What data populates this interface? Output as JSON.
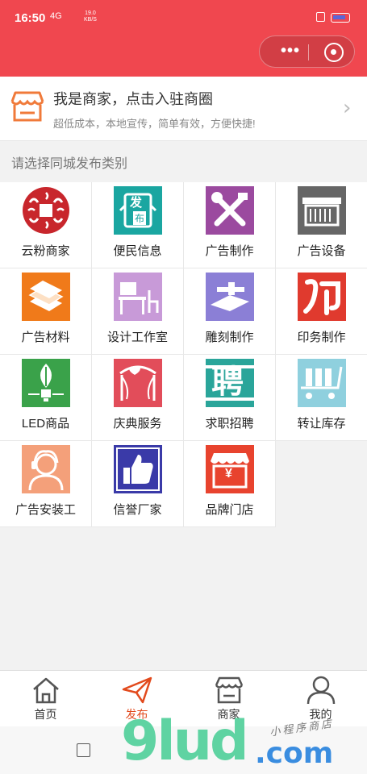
{
  "status_bar": {
    "time": "16:50",
    "signal": "4G",
    "net_speed_value": "19.0",
    "net_speed_unit": "KB/S"
  },
  "capsule": {
    "more_label": "•••"
  },
  "banner": {
    "title": "我是商家，点击入驻商圈",
    "subtitle": "超低成本，本地宣传，简单有效，方便快捷!",
    "accent_color": "#f07a3a"
  },
  "section_label": "请选择同城发布类别",
  "categories": [
    {
      "label": "云粉商家",
      "icon": "cloud-pattern-icon",
      "color": "#c8262c"
    },
    {
      "label": "便民信息",
      "icon": "announcement-icon",
      "color": "#1aa6a1",
      "icon_text_1": "发",
      "icon_text_2": "布"
    },
    {
      "label": "广告制作",
      "icon": "tools-icon",
      "color": "#9b4a9f"
    },
    {
      "label": "广告设备",
      "icon": "printer-icon",
      "color": "#666666"
    },
    {
      "label": "广告材料",
      "icon": "material-stack-icon",
      "color": "#f07a1a"
    },
    {
      "label": "设计工作室",
      "icon": "desk-icon",
      "color": "#c89ad8"
    },
    {
      "label": "雕刻制作",
      "icon": "engraving-machine-icon",
      "color": "#8b7fd6"
    },
    {
      "label": "印务制作",
      "icon": "print-logo-icon",
      "color": "#e03a2e"
    },
    {
      "label": "LED商品",
      "icon": "led-bulb-icon",
      "color": "#3aa24a"
    },
    {
      "label": "庆典服务",
      "icon": "celebration-arch-icon",
      "color": "#e24d5a"
    },
    {
      "label": "求职招聘",
      "icon": "recruitment-icon",
      "color": "#2aa59a",
      "icon_text_1": "聘"
    },
    {
      "label": "转让库存",
      "icon": "cart-icon",
      "color": "#8fd0de"
    },
    {
      "label": "广告安装工",
      "icon": "installer-icon",
      "color": "#f4a07a"
    },
    {
      "label": "信誉厂家",
      "icon": "thumbs-up-icon",
      "color": "#3a3aa8"
    },
    {
      "label": "品牌门店",
      "icon": "storefront-icon",
      "color": "#e8432e",
      "icon_text_1": "¥"
    }
  ],
  "bottom_nav": [
    {
      "label": "首页",
      "icon": "home-icon",
      "active": false
    },
    {
      "label": "发布",
      "icon": "paper-plane-icon",
      "active": true
    },
    {
      "label": "商家",
      "icon": "shop-icon",
      "active": false
    },
    {
      "label": "我的",
      "icon": "user-icon",
      "active": false
    }
  ],
  "watermark": {
    "logo_text": "9lud",
    "domain_text": ".com",
    "tagline": "小程序商店"
  }
}
